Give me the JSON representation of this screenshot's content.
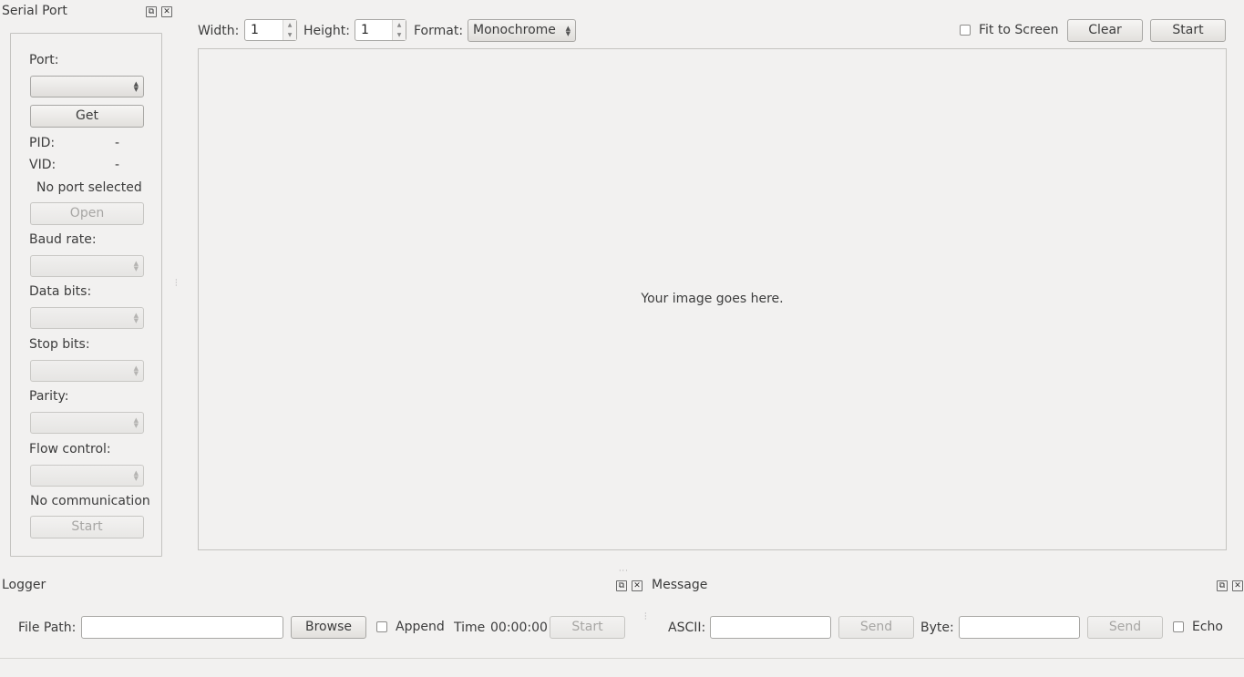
{
  "serial_port": {
    "title": "Serial Port",
    "port_label": "Port:",
    "port_value": "",
    "get_label": "Get",
    "pid_label": "PID:",
    "pid_value": "-",
    "vid_label": "VID:",
    "vid_value": "-",
    "port_status": "No port selected",
    "open_label": "Open",
    "baud_label": "Baud rate:",
    "data_bits_label": "Data bits:",
    "stop_bits_label": "Stop bits:",
    "parity_label": "Parity:",
    "flow_label": "Flow control:",
    "comm_status": "No communication",
    "start_label": "Start"
  },
  "toolbar": {
    "width_label": "Width:",
    "width_value": "1",
    "height_label": "Height:",
    "height_value": "1",
    "format_label": "Format:",
    "format_value": "Monochrome",
    "fit_label": "Fit to Screen",
    "clear_label": "Clear",
    "start_label": "Start"
  },
  "image_area": {
    "placeholder": "Your image goes here."
  },
  "logger": {
    "title": "Logger",
    "file_path_label": "File Path:",
    "file_path_value": "",
    "browse_label": "Browse",
    "append_label": "Append",
    "time_label": "Time",
    "time_value": "00:00:00",
    "start_label": "Start"
  },
  "message": {
    "title": "Message",
    "ascii_label": "ASCII:",
    "ascii_value": "",
    "send_ascii_label": "Send",
    "byte_label": "Byte:",
    "byte_value": "",
    "send_byte_label": "Send",
    "echo_label": "Echo"
  },
  "colors": {
    "background": "#f2f1f0",
    "status_red": "#e00000"
  },
  "icons": [
    "float-icon",
    "close-icon",
    "spin-arrows-icon",
    "combo-arrows-icon",
    "splitter-handle-icon"
  ]
}
